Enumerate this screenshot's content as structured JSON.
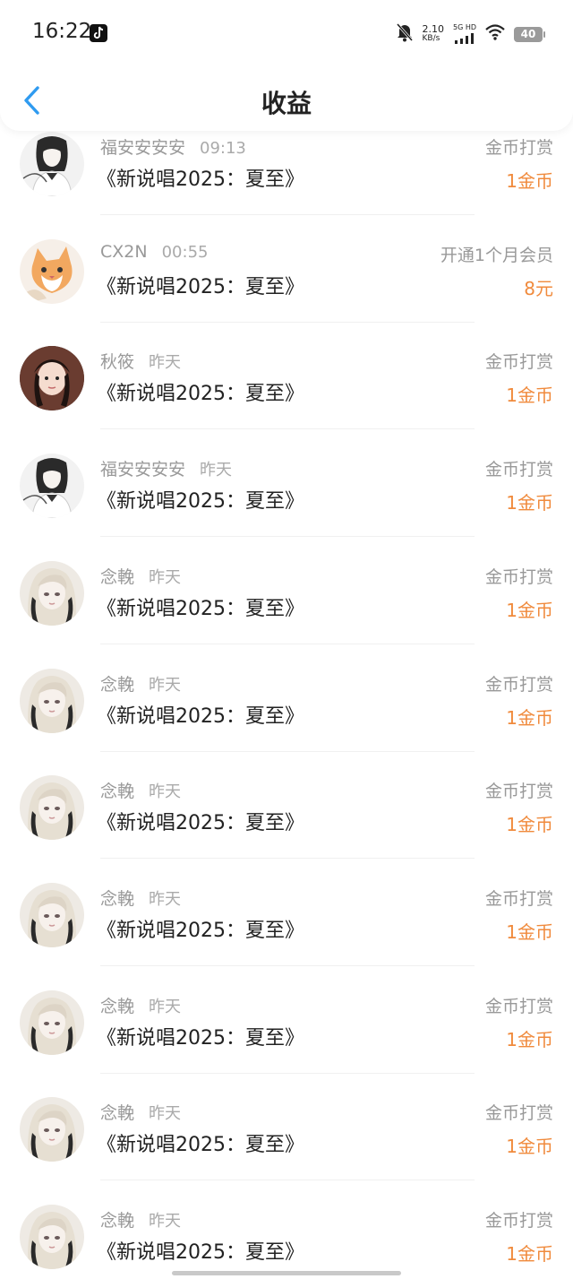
{
  "status_bar": {
    "time": "16:22",
    "net_speed_value": "2.10",
    "net_speed_unit": "KB/s",
    "network": "5G HD",
    "battery": "40"
  },
  "header": {
    "title": "收益"
  },
  "records": [
    {
      "name": "福安安安安",
      "time": "09:13",
      "title": "《新说唱2025：夏至》",
      "type": "金币打赏",
      "amount": "1金币",
      "avatar": "dark-hair"
    },
    {
      "name": "CX2N",
      "time": "00:55",
      "title": "《新说唱2025：夏至》",
      "type": "开通1个月会员",
      "amount": "8元",
      "avatar": "cat"
    },
    {
      "name": "秋筱",
      "time": "昨天",
      "title": "《新说唱2025：夏至》",
      "type": "金币打赏",
      "amount": "1金币",
      "avatar": "braids"
    },
    {
      "name": "福安安安安",
      "time": "昨天",
      "title": "《新说唱2025：夏至》",
      "type": "金币打赏",
      "amount": "1金币",
      "avatar": "dark-hair"
    },
    {
      "name": "念輓",
      "time": "昨天",
      "title": "《新说唱2025：夏至》",
      "type": "金币打赏",
      "amount": "1金币",
      "avatar": "blonde"
    },
    {
      "name": "念輓",
      "time": "昨天",
      "title": "《新说唱2025：夏至》",
      "type": "金币打赏",
      "amount": "1金币",
      "avatar": "blonde"
    },
    {
      "name": "念輓",
      "time": "昨天",
      "title": "《新说唱2025：夏至》",
      "type": "金币打赏",
      "amount": "1金币",
      "avatar": "blonde"
    },
    {
      "name": "念輓",
      "time": "昨天",
      "title": "《新说唱2025：夏至》",
      "type": "金币打赏",
      "amount": "1金币",
      "avatar": "blonde"
    },
    {
      "name": "念輓",
      "time": "昨天",
      "title": "《新说唱2025：夏至》",
      "type": "金币打赏",
      "amount": "1金币",
      "avatar": "blonde"
    },
    {
      "name": "念輓",
      "time": "昨天",
      "title": "《新说唱2025：夏至》",
      "type": "金币打赏",
      "amount": "1金币",
      "avatar": "blonde"
    },
    {
      "name": "念輓",
      "time": "昨天",
      "title": "《新说唱2025：夏至》",
      "type": "金币打赏",
      "amount": "1金币",
      "avatar": "blonde"
    }
  ],
  "colors": {
    "accent_back": "#2f9bf0",
    "amount": "#f08a3c",
    "meta_text": "#999999"
  }
}
